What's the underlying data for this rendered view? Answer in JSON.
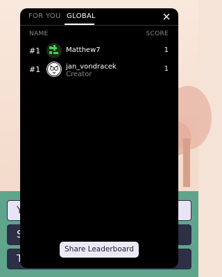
{
  "background": {
    "buttons": [
      {
        "label": "Y",
        "style": "light"
      },
      {
        "label": "S",
        "style": "dark"
      },
      {
        "label": "T",
        "style": "dark"
      }
    ]
  },
  "tabs": [
    {
      "label": "FOR YOU",
      "active": false
    },
    {
      "label": "GLOBAL",
      "active": true
    }
  ],
  "columns": {
    "name": "NAME",
    "score": "SCORE"
  },
  "entries": [
    {
      "rank": "#1",
      "name": "Matthew7",
      "role": "",
      "score": "1",
      "avatar": "green-blocks-icon"
    },
    {
      "rank": "#1",
      "name": "jan_vondracek",
      "role": "Creator",
      "score": "1",
      "avatar": "owl-face-icon"
    }
  ],
  "share_label": "Share Leaderboard",
  "colors": {
    "modal_bg": "#000000",
    "muted_text": "#8a8a8a",
    "share_bg": "#ece9f7",
    "ground": "#5fa58c"
  }
}
